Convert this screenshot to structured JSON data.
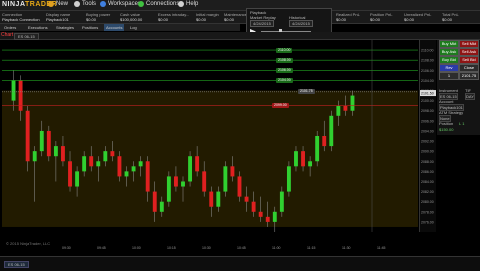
{
  "app": {
    "logo_prefix": "NINJA",
    "logo_suffix": "TRADER"
  },
  "menu": [
    {
      "label": "New",
      "icon": "new-icon",
      "color": "#e0a020"
    },
    {
      "label": "Tools",
      "icon": "tools-icon",
      "color": "#d0d0d0"
    },
    {
      "label": "Workspaces",
      "icon": "workspaces-icon",
      "color": "#4080e0"
    },
    {
      "label": "Connections",
      "icon": "connections-icon",
      "color": "#40c040"
    },
    {
      "label": "Help",
      "icon": "help-icon",
      "color": "#d0d0d0"
    }
  ],
  "accounts": {
    "headers": [
      "Connection",
      "Display name",
      "Buying power",
      "Cash value",
      "Excess intraday...",
      "Initial margin",
      "Maintenance",
      "Net liquidation",
      "Realized PnL",
      "Gross realized PnL",
      "Position PnL",
      "Unrealized PnL",
      "Total PnL"
    ],
    "row": [
      "Playback Connection",
      "Playback101",
      "$0.00",
      "$100,000.00",
      "$0.00",
      "$0.00",
      "$0.00",
      "$100,000.00",
      "$0.00",
      "$0.00",
      "$0.00",
      "$0.00",
      "$0.00"
    ]
  },
  "tabs": [
    "Orders",
    "Executions",
    "Strategies",
    "Positions",
    "Accounts",
    "Log"
  ],
  "simulator": {
    "title": "Playback",
    "label1": "Market Replay",
    "label2": "Historical",
    "date1": "4/24/2015",
    "date2": "4/24/2015"
  },
  "chart_tab": "Chart",
  "instrument": "ES 06-15",
  "order_panel": {
    "buttons": [
      {
        "label": "Buy Mkt",
        "color": "grn"
      },
      {
        "label": "Sell Mkt",
        "color": "red"
      },
      {
        "label": "Buy Ask",
        "color": "grn"
      },
      {
        "label": "Sell Ask",
        "color": "red"
      },
      {
        "label": "Buy Bid",
        "color": "grn"
      },
      {
        "label": "Sell Bid",
        "color": "red"
      },
      {
        "label": "Rev",
        "color": "blu"
      },
      {
        "label": "Close",
        "color": "gry"
      }
    ],
    "qty": "1",
    "price": "2101.75",
    "instrument_label": "Instrument",
    "tif_label": "TIF",
    "tif_value": "DAY",
    "account_label": "Account",
    "account_value": "Playback101",
    "atm_label": "ATM Strategy",
    "atm_value": "None",
    "pos_label": "Position",
    "pos_value": "L 1",
    "pnl": "$150.00"
  },
  "price_levels": {
    "target_orders": [
      {
        "label": "2110.00",
        "price": 2110.0
      },
      {
        "label": "2108.00",
        "price": 2108.0
      },
      {
        "label": "2106.00",
        "price": 2106.0
      },
      {
        "label": "2104.00",
        "price": 2104.0
      }
    ],
    "entry": {
      "label": "2101.75",
      "price": 2101.75
    },
    "stop": {
      "label": "2099.00",
      "price": 2099.0
    },
    "last": "2101.50"
  },
  "chart_data": {
    "type": "candlestick",
    "ylim": [
      2074,
      2112
    ],
    "yticks": [
      "2110.00",
      "2108.00",
      "2106.00",
      "2104.00",
      "2102.00",
      "2100.00",
      "2098.00",
      "2096.00",
      "2094.00",
      "2092.00",
      "2090.00",
      "2088.00",
      "2086.00",
      "2084.00",
      "2082.00",
      "2080.00",
      "2078.00",
      "2076.00"
    ],
    "xticks": [
      "09:30",
      "09:45",
      "10:00",
      "10:15",
      "10:30",
      "10:45",
      "11:00",
      "11:15",
      "11:30",
      "11:45"
    ],
    "candles": [
      [
        2100,
        2106,
        2098,
        2104
      ],
      [
        2104,
        2105,
        2096,
        2098
      ],
      [
        2098,
        2099,
        2086,
        2088
      ],
      [
        2088,
        2091,
        2080,
        2090
      ],
      [
        2090,
        2096,
        2089,
        2094
      ],
      [
        2094,
        2095,
        2088,
        2089
      ],
      [
        2089,
        2092,
        2084,
        2091
      ],
      [
        2091,
        2093,
        2087,
        2088
      ],
      [
        2088,
        2090,
        2082,
        2083
      ],
      [
        2083,
        2087,
        2081,
        2086
      ],
      [
        2086,
        2090,
        2085,
        2089
      ],
      [
        2089,
        2091,
        2086,
        2087
      ],
      [
        2087,
        2089,
        2084,
        2088
      ],
      [
        2088,
        2091,
        2087,
        2090
      ],
      [
        2090,
        2092,
        2088,
        2089
      ],
      [
        2089,
        2090,
        2084,
        2085
      ],
      [
        2085,
        2087,
        2083,
        2086
      ],
      [
        2086,
        2088,
        2084,
        2087
      ],
      [
        2087,
        2089,
        2085,
        2088
      ],
      [
        2088,
        2089,
        2080,
        2082
      ],
      [
        2082,
        2084,
        2076,
        2078
      ],
      [
        2078,
        2081,
        2077,
        2080
      ],
      [
        2080,
        2086,
        2079,
        2085
      ],
      [
        2085,
        2087,
        2082,
        2083
      ],
      [
        2083,
        2085,
        2080,
        2084
      ],
      [
        2084,
        2090,
        2083,
        2089
      ],
      [
        2089,
        2091,
        2085,
        2086
      ],
      [
        2086,
        2088,
        2081,
        2082
      ],
      [
        2082,
        2083,
        2077,
        2079
      ],
      [
        2079,
        2083,
        2078,
        2082
      ],
      [
        2082,
        2088,
        2081,
        2087
      ],
      [
        2087,
        2089,
        2084,
        2085
      ],
      [
        2085,
        2086,
        2080,
        2081
      ],
      [
        2081,
        2083,
        2078,
        2080
      ],
      [
        2080,
        2082,
        2077,
        2078
      ],
      [
        2078,
        2081,
        2076,
        2077
      ],
      [
        2077,
        2080,
        2075,
        2076
      ],
      [
        2076,
        2079,
        2074,
        2078
      ],
      [
        2078,
        2083,
        2077,
        2082
      ],
      [
        2082,
        2088,
        2081,
        2087
      ],
      [
        2087,
        2091,
        2086,
        2090
      ],
      [
        2090,
        2091,
        2086,
        2087
      ],
      [
        2087,
        2089,
        2085,
        2088
      ],
      [
        2088,
        2094,
        2087,
        2093
      ],
      [
        2093,
        2096,
        2090,
        2091
      ],
      [
        2091,
        2098,
        2090,
        2097
      ],
      [
        2097,
        2100,
        2095,
        2099
      ],
      [
        2099,
        2101,
        2097,
        2098
      ],
      [
        2098,
        2102,
        2097,
        2101
      ]
    ]
  },
  "status": {
    "left": "ES 06-15",
    "copyright": "© 2015 NinjaTrader, LLC"
  }
}
